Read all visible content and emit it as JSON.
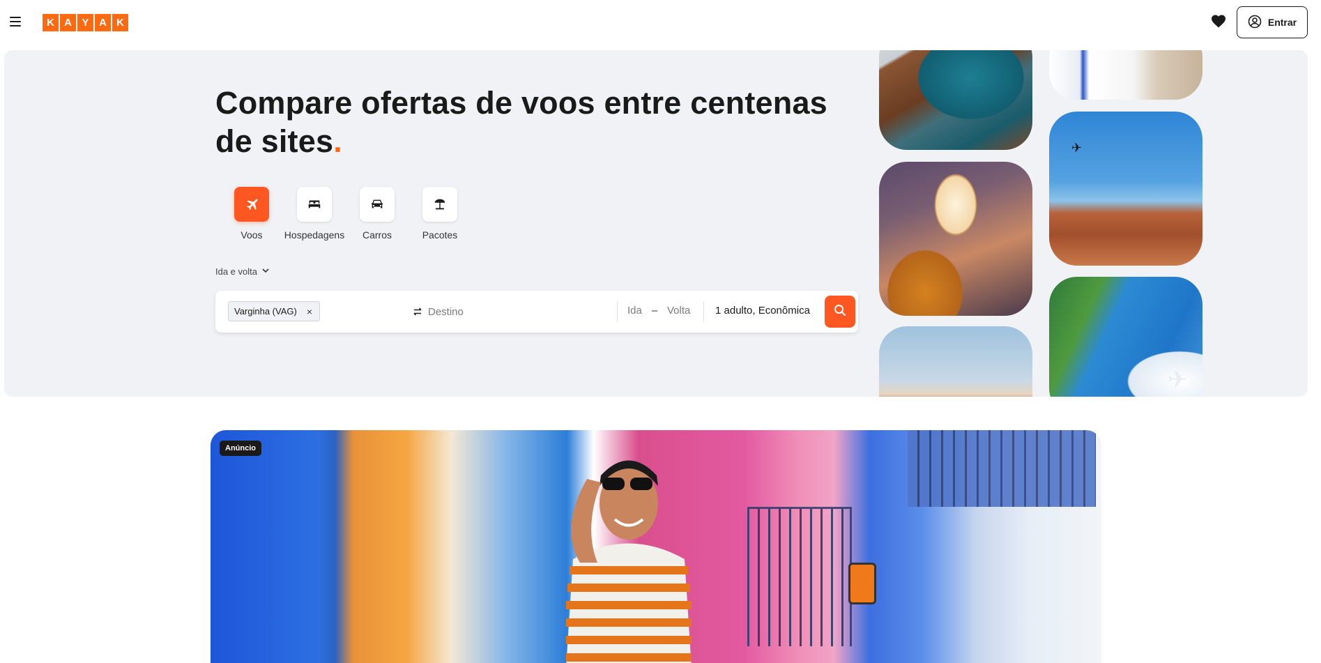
{
  "header": {
    "logo_letters": [
      "K",
      "A",
      "Y",
      "A",
      "K"
    ],
    "signin_label": "Entrar",
    "icons": {
      "menu": "hamburger-menu-icon",
      "favorites": "heart-icon",
      "account": "user-circle-icon"
    }
  },
  "hero": {
    "title": "Compare ofertas de voos entre centenas de sites",
    "title_dot": ".",
    "verticals": [
      {
        "label": "Voos",
        "icon": "airplane-icon",
        "active": true
      },
      {
        "label": "Hospedagens",
        "icon": "bed-icon",
        "active": false
      },
      {
        "label": "Carros",
        "icon": "car-icon",
        "active": false
      },
      {
        "label": "Pacotes",
        "icon": "beach-umbrella-icon",
        "active": false
      }
    ],
    "trip_type": "Ida e volta"
  },
  "search": {
    "origin": "Varginha (VAG)",
    "origin_remove": "×",
    "destination_placeholder": "Destino",
    "depart": "Ida",
    "date_separator": "–",
    "return": "Volta",
    "travelers": "1 adulto, Econômica"
  },
  "ad": {
    "badge": "Anúncio"
  },
  "colors": {
    "brand": "#ff690f",
    "accent_button": "#ff5722",
    "hero_bg": "#f0f2f5"
  }
}
